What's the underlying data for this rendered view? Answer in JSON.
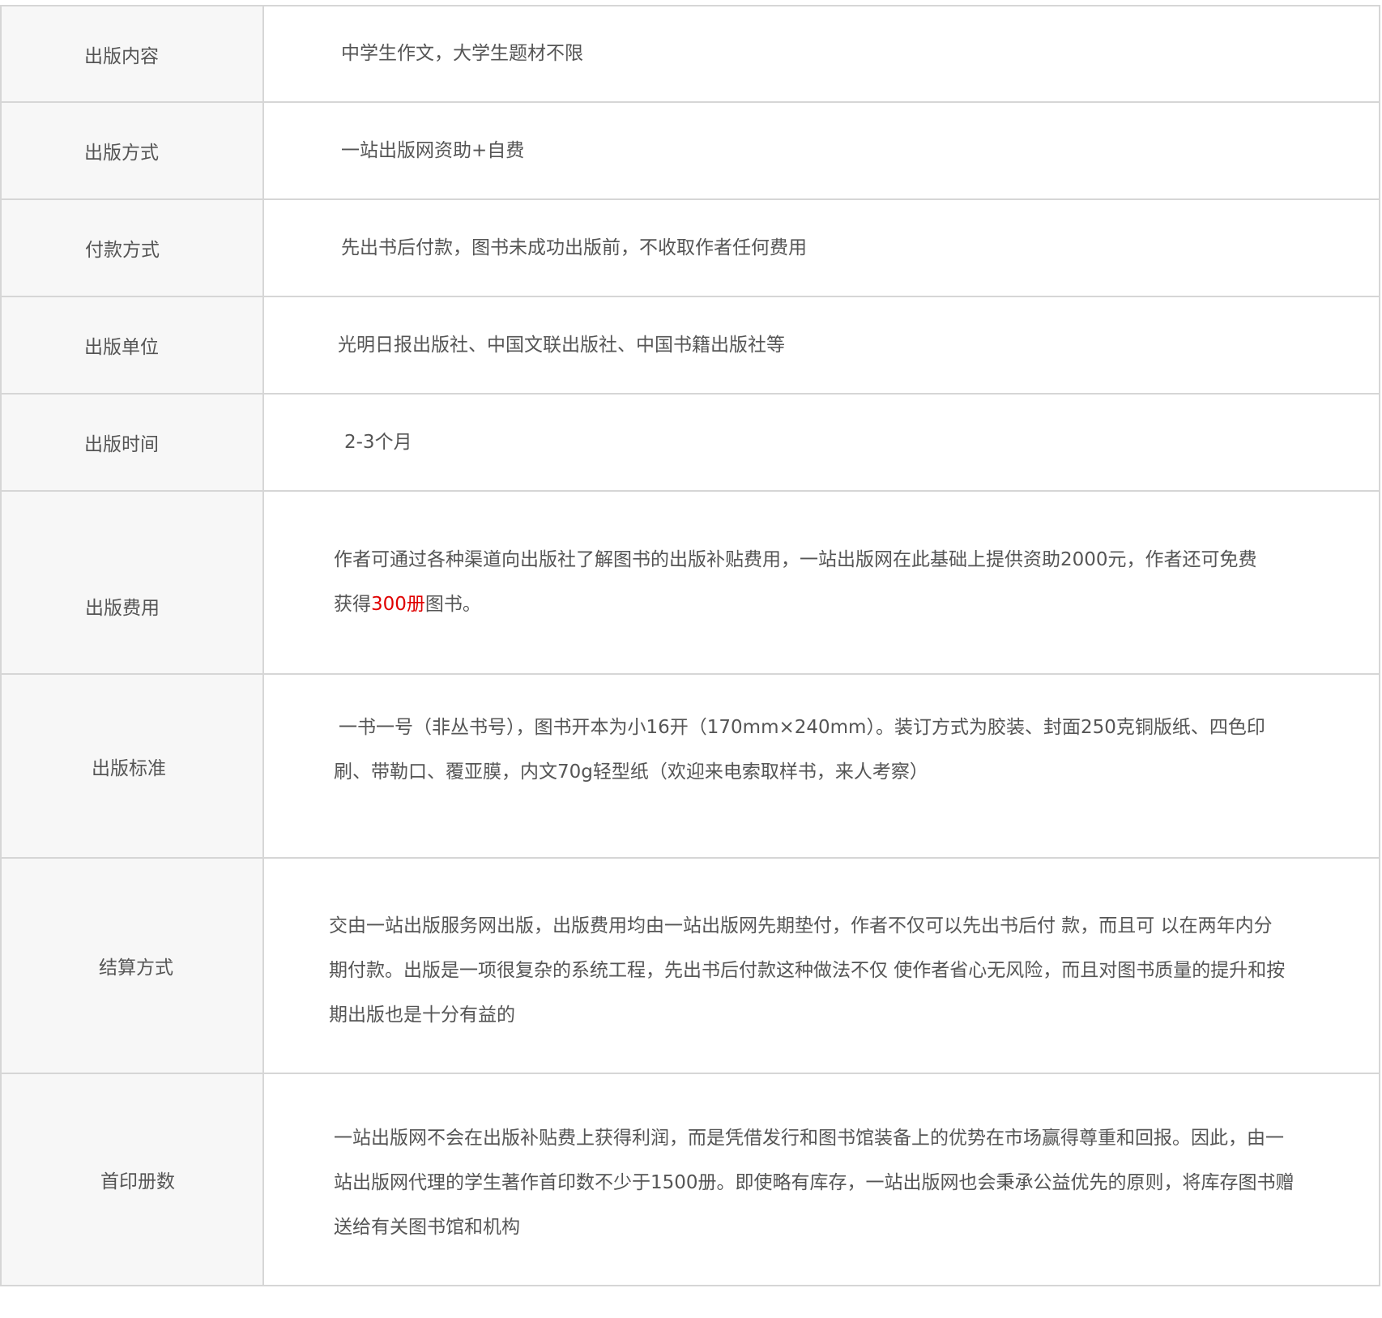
{
  "rows": [
    {
      "label": "出版内容",
      "value": "中学生作文，大学生题材不限"
    },
    {
      "label": "出版方式",
      "value": "一站出版网资助+自费"
    },
    {
      "label": "付款方式",
      "value": "先出书后付款，图书未成功出版前，不收取作者任何费用"
    },
    {
      "label": "出版单位",
      "value": "光明日报出版社、中国文联出版社、中国书籍出版社等"
    },
    {
      "label": "出版时间",
      "value": "2-3个月"
    },
    {
      "label": "出版费用",
      "value_line1": "作者可通过各种渠道向出版社了解图书的出版补贴费用，一站出版网在此基础上提供资助2000元，作者还可免费",
      "value_pre": "获得",
      "value_highlight": "300册",
      "value_post": "图书。",
      "highlight_color": "#e00000"
    },
    {
      "label": "出版标准",
      "value_line1": "一书一号（非丛书号），图书开本为小16开（170mm×240mm）。装订方式为胶装、封面250克铜版纸、四色印",
      "value_line2": "刷、带勒口、覆亚膜，内文70g轻型纸（欢迎来电索取样书，来人考察）"
    },
    {
      "label": "结算方式",
      "value_line1": "交由一站出版服务网出版，出版费用均由一站出版网先期垫付，作者不仅可以先出书后付 款，而且可 以在两年内分",
      "value_line2": "期付款。出版是一项很复杂的系统工程，先出书后付款这种做法不仅 使作者省心无风险，而且对图书质量的提升和按",
      "value_line3": "期出版也是十分有益的"
    },
    {
      "label": "首印册数",
      "value_line1": "一站出版网不会在出版补贴费上获得利润，而是凭借发行和图书馆装备上的优势在市场赢得尊重和回报。因此，由一",
      "value_line2": "站出版网代理的学生著作首印数不少于1500册。即使略有库存，一站出版网也会秉承公益优先的原则，将库存图书赠",
      "value_line3": "送给有关图书馆和机构"
    }
  ]
}
